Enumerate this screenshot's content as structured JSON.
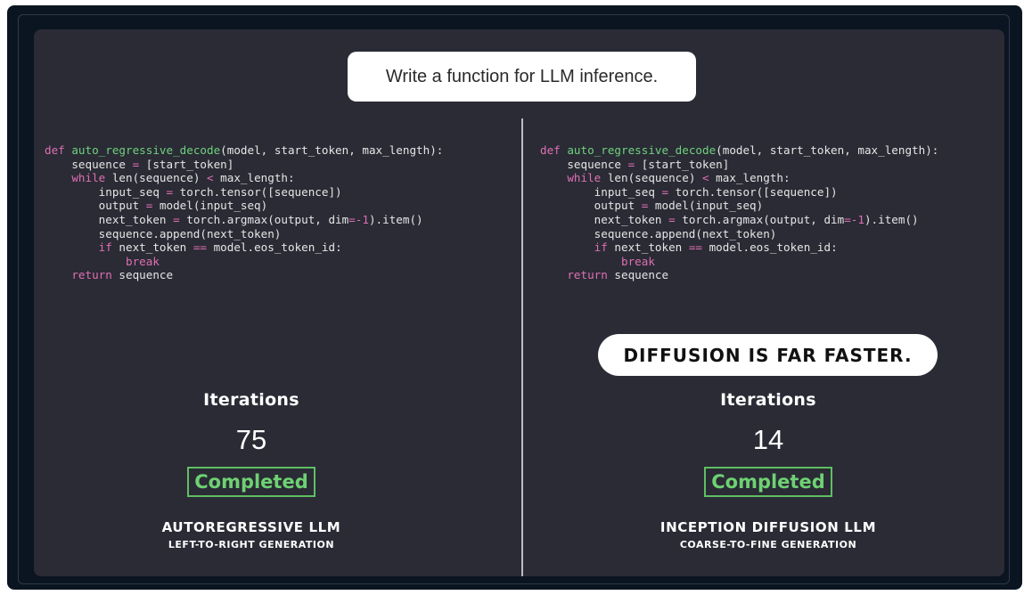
{
  "prompt": "Write a function for LLM inference.",
  "code": {
    "lines": [
      [
        {
          "t": "def",
          "c": "kw"
        },
        {
          "t": " "
        },
        {
          "t": "auto_regressive_decode",
          "c": "fn"
        },
        {
          "t": "(model, start_token, max_length):"
        }
      ],
      [
        {
          "t": "    sequence "
        },
        {
          "t": "=",
          "c": "kw"
        },
        {
          "t": " [start_token]"
        }
      ],
      [
        {
          "t": "    "
        },
        {
          "t": "while",
          "c": "kw"
        },
        {
          "t": " len(sequence) "
        },
        {
          "t": "<",
          "c": "kw"
        },
        {
          "t": " max_length:"
        }
      ],
      [
        {
          "t": "        input_seq "
        },
        {
          "t": "=",
          "c": "kw"
        },
        {
          "t": " torch.tensor([sequence])"
        }
      ],
      [
        {
          "t": "        output "
        },
        {
          "t": "=",
          "c": "kw"
        },
        {
          "t": " model(input_seq)"
        }
      ],
      [
        {
          "t": "        next_token "
        },
        {
          "t": "=",
          "c": "kw"
        },
        {
          "t": " torch.argmax(output, dim"
        },
        {
          "t": "=-1",
          "c": "kw"
        },
        {
          "t": ").item()"
        }
      ],
      [
        {
          "t": "        sequence.append(next_token)"
        }
      ],
      [
        {
          "t": "        "
        },
        {
          "t": "if",
          "c": "kw"
        },
        {
          "t": " next_token "
        },
        {
          "t": "==",
          "c": "kw"
        },
        {
          "t": " model.eos_token_id:"
        }
      ],
      [
        {
          "t": "            "
        },
        {
          "t": "break",
          "c": "kw"
        }
      ],
      [
        {
          "t": "    "
        },
        {
          "t": "return",
          "c": "kw"
        },
        {
          "t": " sequence"
        }
      ]
    ]
  },
  "left": {
    "iterations_label": "Iterations",
    "iterations_value": "75",
    "status": "Completed",
    "model_name": "AUTOREGRESSIVE LLM",
    "model_subtitle": "LEFT-TO-RIGHT GENERATION"
  },
  "right": {
    "callout": "DIFFUSION IS FAR FASTER.",
    "iterations_label": "Iterations",
    "iterations_value": "14",
    "status": "Completed",
    "model_name": "INCEPTION DIFFUSION LLM",
    "model_subtitle": "COARSE-TO-FINE GENERATION"
  },
  "colors": {
    "background": "#2a2b35",
    "keyword": "#e06fb4",
    "function_name": "#6fd17e",
    "status_green": "#6ed172"
  }
}
